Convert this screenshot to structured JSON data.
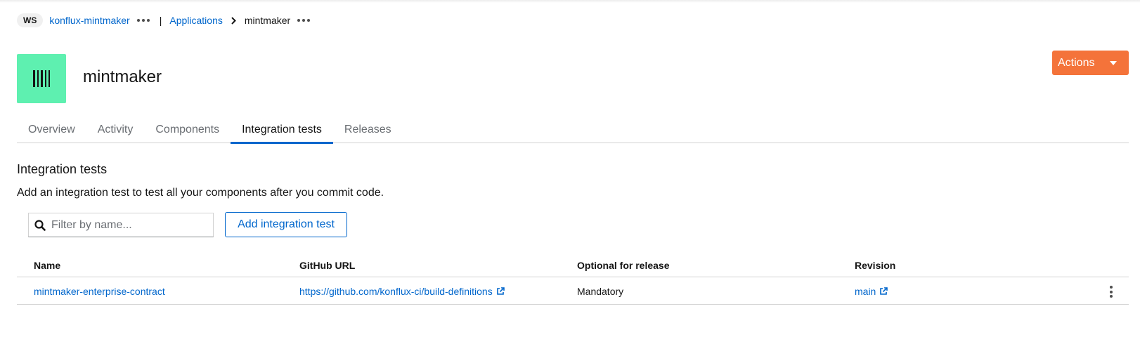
{
  "breadcrumb": {
    "workspace_badge": "WS",
    "workspace": "konflux-mintmaker",
    "separator": "|",
    "applications": "Applications",
    "current": "mintmaker"
  },
  "header": {
    "title": "mintmaker",
    "actions_label": "Actions",
    "icon_color": "#5ef0b0",
    "actions_color": "#f4733a"
  },
  "tabs": [
    {
      "label": "Overview",
      "active": false
    },
    {
      "label": "Activity",
      "active": false
    },
    {
      "label": "Components",
      "active": false
    },
    {
      "label": "Integration tests",
      "active": true
    },
    {
      "label": "Releases",
      "active": false
    }
  ],
  "section": {
    "title": "Integration tests",
    "description": "Add an integration test to test all your components after you commit code."
  },
  "toolbar": {
    "filter_placeholder": "Filter by name...",
    "add_label": "Add integration test"
  },
  "table": {
    "columns": [
      "Name",
      "GitHub URL",
      "Optional for release",
      "Revision"
    ],
    "rows": [
      {
        "name": "mintmaker-enterprise-contract",
        "github_url": "https://github.com/konflux-ci/build-definitions",
        "optional": "Mandatory",
        "revision": "main"
      }
    ]
  },
  "icons": {
    "app": "barcode-icon",
    "search": "search-icon",
    "external": "external-link-icon",
    "kebab": "kebab-icon",
    "chevron": "chevron-right-icon",
    "caret": "caret-down-icon"
  },
  "colors": {
    "link": "#0066cc",
    "tab_active_underline": "#0066cc"
  }
}
